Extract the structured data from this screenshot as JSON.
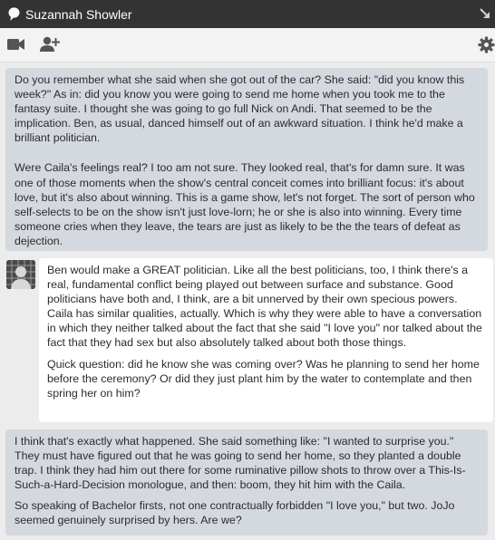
{
  "window": {
    "title": "Suzannah Showler"
  },
  "icons": {
    "title": "chat-bubble",
    "collapse": "collapse-arrow",
    "video": "video-camera",
    "add_user": "add-user",
    "settings": "gear"
  },
  "colors": {
    "titlebar": "#333333",
    "toolbar": "#f3f3f3",
    "chat_background": "#ececec",
    "message_gray": "#d4d9df",
    "message_white": "#ffffff",
    "text": "#2b2b2b"
  },
  "messages": [
    {
      "style": "gray",
      "paragraphs": [
        "Do you remember what she said when she got out of the car? She said: \"did you know this week?\" As in: did you know you were going to send me home when you took me to the fantasy suite. I thought she was going to go full Nick on Andi. That seemed to be the implication. Ben, as usual, danced himself out of an awkward situation. I think he'd make a brilliant politician.",
        "Were Caila's feelings real? I too am not sure. They looked real, that's for damn sure. It was one of those moments when the show's central conceit comes into brilliant focus: it's about love, but it's also about winning. This is a game show, let's not forget. The sort of person who self-selects to be on the show isn't just love-lorn; he or she is also into winning. Every time someone cries when they leave, the tears are just as likely to be the the tears of defeat as dejection."
      ]
    },
    {
      "style": "white",
      "has_avatar": true,
      "paragraphs": [
        "Ben would make a GREAT politician. Like all the best politicians, too, I think there's a real, fundamental conflict being played out between surface and substance. Good politicians have both and, I think, are a bit unnerved by their own specious powers. Caila has similar qualities, actually. Which is why they were able to have a conversation in which they neither talked about the fact that she said \"I love you\" nor talked about the fact that they had sex but also absolutely talked about both those things.",
        "Quick question: did he know she was coming over? Was he planning to send her home before the ceremony? Or did they just plant him by the water to contemplate and then spring her on him?"
      ]
    },
    {
      "style": "gray",
      "paragraphs": [
        "I think that's exactly what happened. She said something like: \"I wanted to surprise you.\" They must have figured out that he was going to send her home, so they planted a double trap. I think they had him out there for some ruminative pillow shots to throw over a This-Is-Such-a-Hard-Decision monologue, and then: boom, they hit him with the Caila.",
        "So speaking of Bachelor firsts, not one contractually forbidden \"I love you,\" but two. JoJo seemed genuinely surprised by hers. Are we?"
      ]
    }
  ]
}
